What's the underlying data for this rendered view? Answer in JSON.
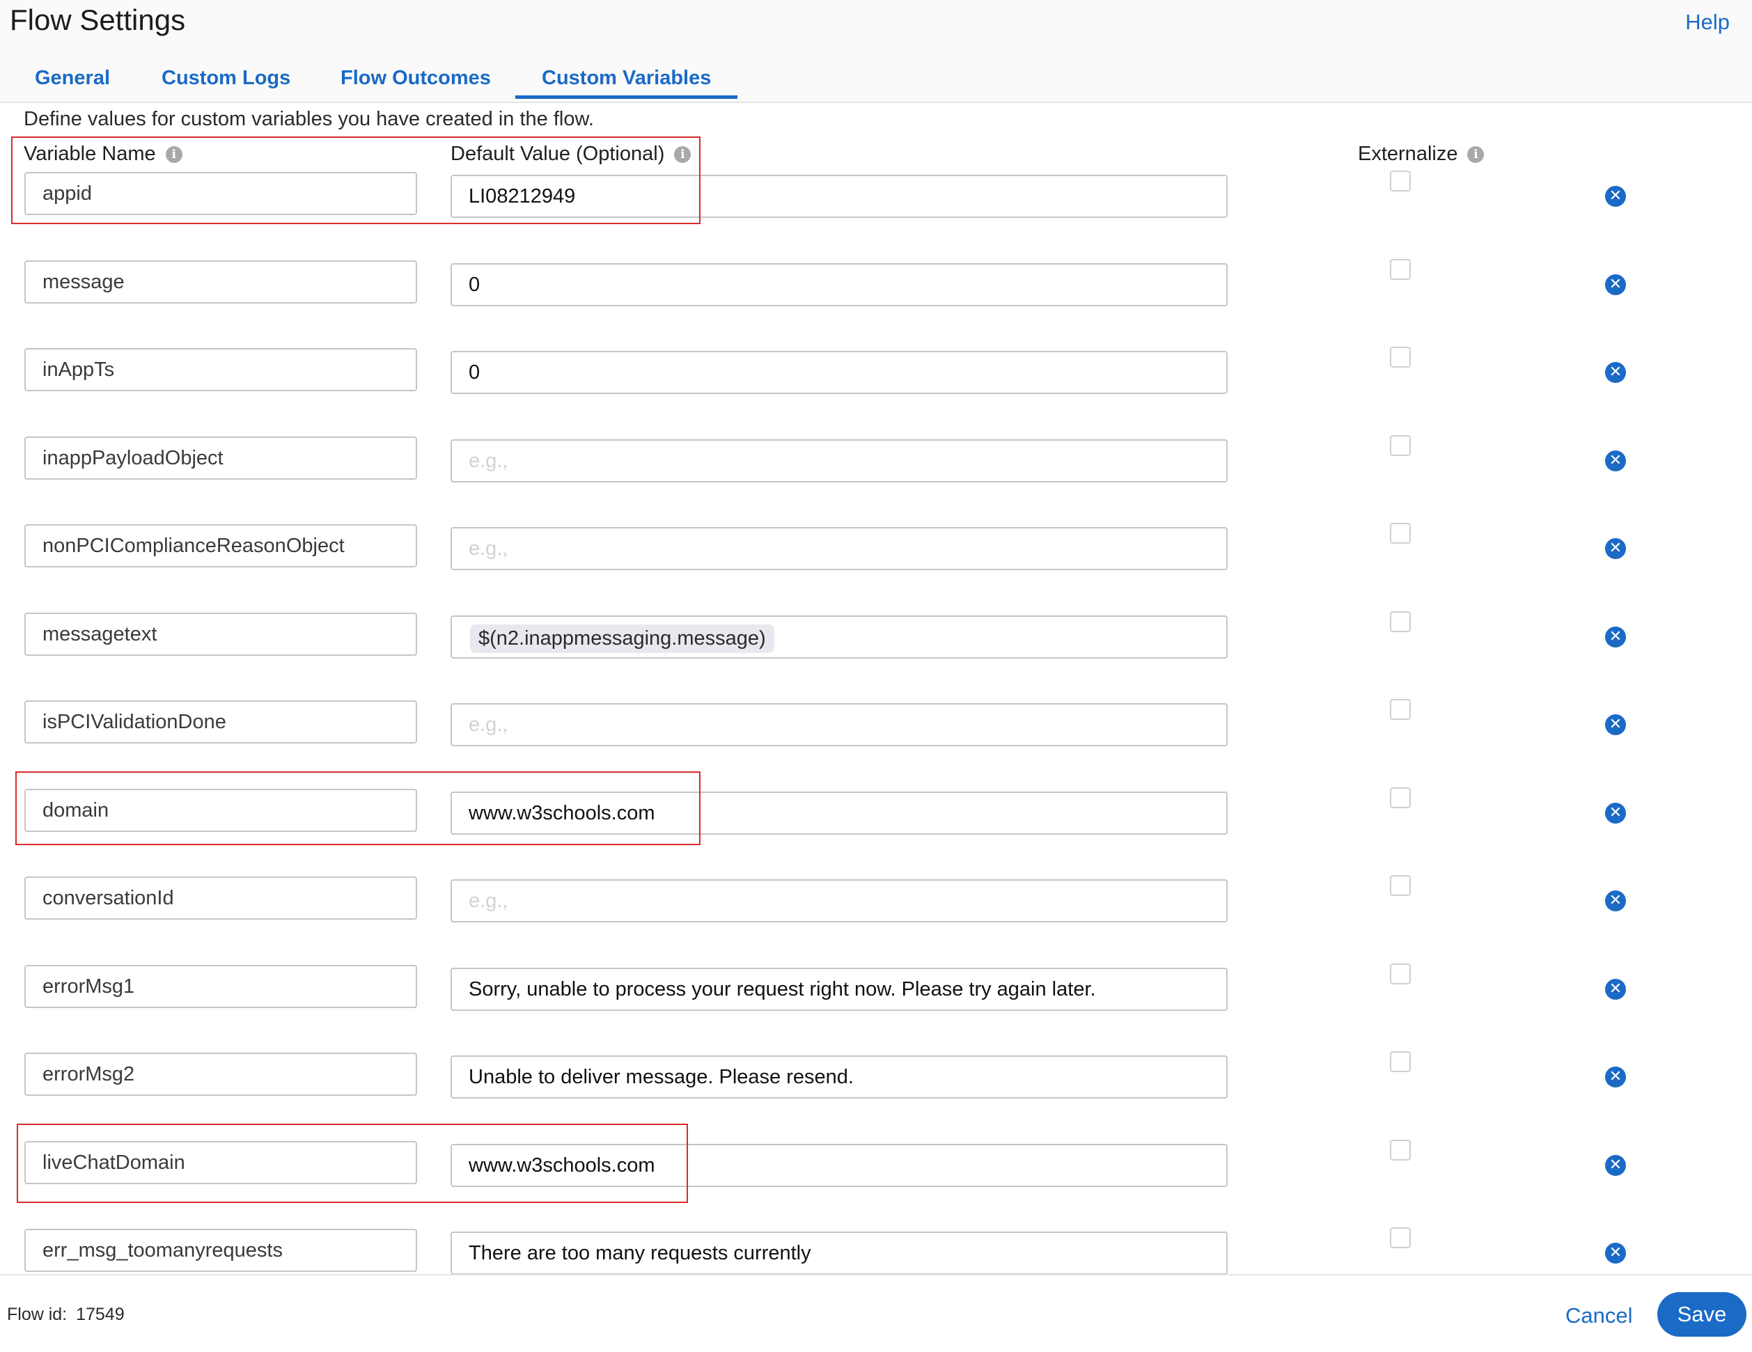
{
  "header": {
    "title": "Flow Settings",
    "help": "Help"
  },
  "tabs": [
    {
      "label": "General",
      "active": false
    },
    {
      "label": "Custom Logs",
      "active": false
    },
    {
      "label": "Flow Outcomes",
      "active": false
    },
    {
      "label": "Custom Variables",
      "active": true
    }
  ],
  "description": "Define values for custom variables you have created in the flow.",
  "columns": {
    "name": "Variable Name",
    "value": "Default Value (Optional)",
    "externalize": "Externalize"
  },
  "placeholder": "e.g.,",
  "rows": [
    {
      "name": "appid",
      "value": "LI08212949",
      "externalized": false
    },
    {
      "name": "message",
      "value": "0",
      "externalized": false
    },
    {
      "name": "inAppTs",
      "value": "0",
      "externalized": false
    },
    {
      "name": "inappPayloadObject",
      "value": "",
      "externalized": false
    },
    {
      "name": "nonPCIComplianceReasonObject",
      "value": "",
      "externalized": false
    },
    {
      "name": "messagetext",
      "value": "$(n2.inappmessaging.message)",
      "externalized": false
    },
    {
      "name": "isPCIValidationDone",
      "value": "",
      "externalized": false
    },
    {
      "name": "domain",
      "value": "www.w3schools.com",
      "externalized": false
    },
    {
      "name": "conversationId",
      "value": "",
      "externalized": false
    },
    {
      "name": "errorMsg1",
      "value": "Sorry, unable to process your request right now. Please try again later.",
      "externalized": false
    },
    {
      "name": "errorMsg2",
      "value": "Unable to deliver message. Please resend.",
      "externalized": false
    },
    {
      "name": "liveChatDomain",
      "value": "www.w3schools.com",
      "externalized": false
    },
    {
      "name": "err_msg_toomanyrequests",
      "value": "There are too many requests currently",
      "externalized": false
    }
  ],
  "footer": {
    "flow_id_label": "Flow id:",
    "flow_id": "17549",
    "cancel": "Cancel",
    "save": "Save"
  },
  "colors": {
    "accent": "#1b6ac6",
    "highlight": "#d92b2b"
  },
  "icons": {
    "info": "info-icon",
    "remove": "remove-circle-icon"
  }
}
